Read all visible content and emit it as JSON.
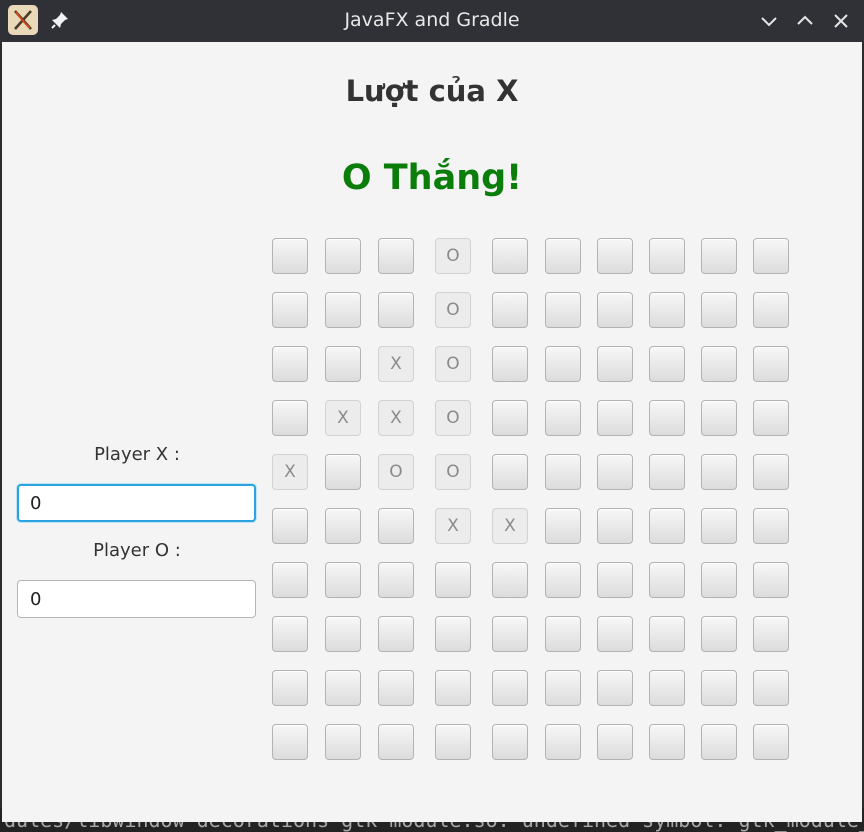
{
  "window": {
    "title": "JavaFX and Gradle"
  },
  "terminal": {
    "text": "dules/libwindow-decorations-gtk-module.so: undefined symbol: gtk_module_i"
  },
  "game": {
    "turn_text": "Lượt của X",
    "result_text": "O Thắng!",
    "result_color": "#0b7d0b",
    "players": {
      "x_label": "Player X :",
      "x_score": "0",
      "o_label": "Player O :",
      "o_score": "0"
    },
    "board": [
      [
        "",
        "",
        "",
        "O",
        "",
        "",
        "",
        "",
        "",
        ""
      ],
      [
        "",
        "",
        "",
        "O",
        "",
        "",
        "",
        "",
        "",
        ""
      ],
      [
        "",
        "",
        "X",
        "O",
        "",
        "",
        "",
        "",
        "",
        ""
      ],
      [
        "",
        "X",
        "X",
        "O",
        "",
        "",
        "",
        "",
        "",
        ""
      ],
      [
        "X",
        "",
        "O",
        "O",
        "",
        "",
        "",
        "",
        "",
        ""
      ],
      [
        "",
        "",
        "",
        "X",
        "X",
        "",
        "",
        "",
        "",
        ""
      ],
      [
        "",
        "",
        "",
        "",
        "",
        "",
        "",
        "",
        "",
        ""
      ],
      [
        "",
        "",
        "",
        "",
        "",
        "",
        "",
        "",
        "",
        ""
      ],
      [
        "",
        "",
        "",
        "",
        "",
        "",
        "",
        "",
        "",
        ""
      ],
      [
        "",
        "",
        "",
        "",
        "",
        "",
        "",
        "",
        "",
        ""
      ]
    ]
  },
  "icons": {
    "app": "javafx-app-icon",
    "pin": "pin-icon",
    "minimize": "chevron-down-icon",
    "maximize": "chevron-up-icon",
    "close": "close-icon"
  }
}
